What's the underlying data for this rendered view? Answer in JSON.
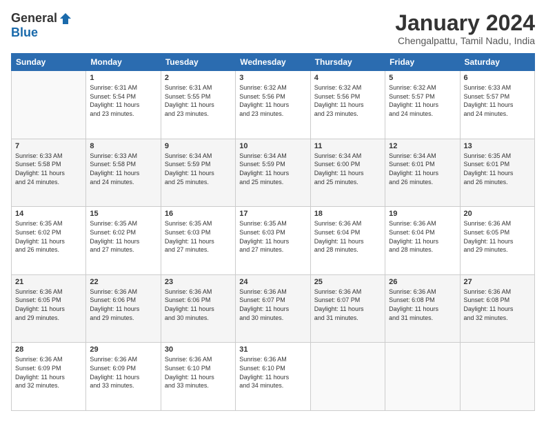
{
  "header": {
    "logo_general": "General",
    "logo_blue": "Blue",
    "month_title": "January 2024",
    "location": "Chengalpattu, Tamil Nadu, India"
  },
  "days_of_week": [
    "Sunday",
    "Monday",
    "Tuesday",
    "Wednesday",
    "Thursday",
    "Friday",
    "Saturday"
  ],
  "weeks": [
    [
      {
        "day": "",
        "info": ""
      },
      {
        "day": "1",
        "info": "Sunrise: 6:31 AM\nSunset: 5:54 PM\nDaylight: 11 hours\nand 23 minutes."
      },
      {
        "day": "2",
        "info": "Sunrise: 6:31 AM\nSunset: 5:55 PM\nDaylight: 11 hours\nand 23 minutes."
      },
      {
        "day": "3",
        "info": "Sunrise: 6:32 AM\nSunset: 5:56 PM\nDaylight: 11 hours\nand 23 minutes."
      },
      {
        "day": "4",
        "info": "Sunrise: 6:32 AM\nSunset: 5:56 PM\nDaylight: 11 hours\nand 23 minutes."
      },
      {
        "day": "5",
        "info": "Sunrise: 6:32 AM\nSunset: 5:57 PM\nDaylight: 11 hours\nand 24 minutes."
      },
      {
        "day": "6",
        "info": "Sunrise: 6:33 AM\nSunset: 5:57 PM\nDaylight: 11 hours\nand 24 minutes."
      }
    ],
    [
      {
        "day": "7",
        "info": "Sunrise: 6:33 AM\nSunset: 5:58 PM\nDaylight: 11 hours\nand 24 minutes."
      },
      {
        "day": "8",
        "info": "Sunrise: 6:33 AM\nSunset: 5:58 PM\nDaylight: 11 hours\nand 24 minutes."
      },
      {
        "day": "9",
        "info": "Sunrise: 6:34 AM\nSunset: 5:59 PM\nDaylight: 11 hours\nand 25 minutes."
      },
      {
        "day": "10",
        "info": "Sunrise: 6:34 AM\nSunset: 5:59 PM\nDaylight: 11 hours\nand 25 minutes."
      },
      {
        "day": "11",
        "info": "Sunrise: 6:34 AM\nSunset: 6:00 PM\nDaylight: 11 hours\nand 25 minutes."
      },
      {
        "day": "12",
        "info": "Sunrise: 6:34 AM\nSunset: 6:01 PM\nDaylight: 11 hours\nand 26 minutes."
      },
      {
        "day": "13",
        "info": "Sunrise: 6:35 AM\nSunset: 6:01 PM\nDaylight: 11 hours\nand 26 minutes."
      }
    ],
    [
      {
        "day": "14",
        "info": "Sunrise: 6:35 AM\nSunset: 6:02 PM\nDaylight: 11 hours\nand 26 minutes."
      },
      {
        "day": "15",
        "info": "Sunrise: 6:35 AM\nSunset: 6:02 PM\nDaylight: 11 hours\nand 27 minutes."
      },
      {
        "day": "16",
        "info": "Sunrise: 6:35 AM\nSunset: 6:03 PM\nDaylight: 11 hours\nand 27 minutes."
      },
      {
        "day": "17",
        "info": "Sunrise: 6:35 AM\nSunset: 6:03 PM\nDaylight: 11 hours\nand 27 minutes."
      },
      {
        "day": "18",
        "info": "Sunrise: 6:36 AM\nSunset: 6:04 PM\nDaylight: 11 hours\nand 28 minutes."
      },
      {
        "day": "19",
        "info": "Sunrise: 6:36 AM\nSunset: 6:04 PM\nDaylight: 11 hours\nand 28 minutes."
      },
      {
        "day": "20",
        "info": "Sunrise: 6:36 AM\nSunset: 6:05 PM\nDaylight: 11 hours\nand 29 minutes."
      }
    ],
    [
      {
        "day": "21",
        "info": "Sunrise: 6:36 AM\nSunset: 6:05 PM\nDaylight: 11 hours\nand 29 minutes."
      },
      {
        "day": "22",
        "info": "Sunrise: 6:36 AM\nSunset: 6:06 PM\nDaylight: 11 hours\nand 29 minutes."
      },
      {
        "day": "23",
        "info": "Sunrise: 6:36 AM\nSunset: 6:06 PM\nDaylight: 11 hours\nand 30 minutes."
      },
      {
        "day": "24",
        "info": "Sunrise: 6:36 AM\nSunset: 6:07 PM\nDaylight: 11 hours\nand 30 minutes."
      },
      {
        "day": "25",
        "info": "Sunrise: 6:36 AM\nSunset: 6:07 PM\nDaylight: 11 hours\nand 31 minutes."
      },
      {
        "day": "26",
        "info": "Sunrise: 6:36 AM\nSunset: 6:08 PM\nDaylight: 11 hours\nand 31 minutes."
      },
      {
        "day": "27",
        "info": "Sunrise: 6:36 AM\nSunset: 6:08 PM\nDaylight: 11 hours\nand 32 minutes."
      }
    ],
    [
      {
        "day": "28",
        "info": "Sunrise: 6:36 AM\nSunset: 6:09 PM\nDaylight: 11 hours\nand 32 minutes."
      },
      {
        "day": "29",
        "info": "Sunrise: 6:36 AM\nSunset: 6:09 PM\nDaylight: 11 hours\nand 33 minutes."
      },
      {
        "day": "30",
        "info": "Sunrise: 6:36 AM\nSunset: 6:10 PM\nDaylight: 11 hours\nand 33 minutes."
      },
      {
        "day": "31",
        "info": "Sunrise: 6:36 AM\nSunset: 6:10 PM\nDaylight: 11 hours\nand 34 minutes."
      },
      {
        "day": "",
        "info": ""
      },
      {
        "day": "",
        "info": ""
      },
      {
        "day": "",
        "info": ""
      }
    ]
  ]
}
